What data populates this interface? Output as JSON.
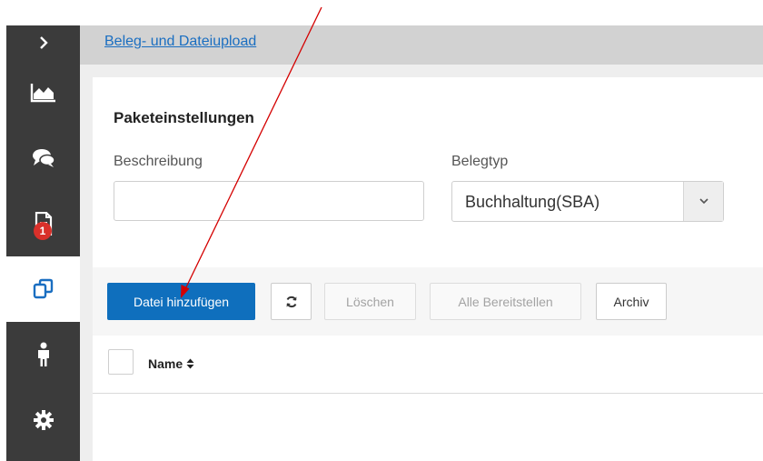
{
  "colors": {
    "sidebar_bg": "#3b3b3b",
    "primary": "#0f6fbd",
    "badge": "#d9302a",
    "link": "#1a6ec1",
    "annotation_arrow": "#d40000"
  },
  "sidebar": {
    "items": [
      {
        "icon": "chevron-right-icon"
      },
      {
        "icon": "area-chart-icon"
      },
      {
        "icon": "chat-icon"
      },
      {
        "icon": "document-icon",
        "badge": "1"
      },
      {
        "icon": "copy-icon",
        "active": true
      },
      {
        "icon": "person-icon"
      },
      {
        "icon": "gear-icon"
      }
    ]
  },
  "header": {
    "breadcrumb": "Beleg- und Dateiupload"
  },
  "form": {
    "title": "Paketeinstellungen",
    "description_label": "Beschreibung",
    "description_value": "",
    "doc_type_label": "Belegtyp",
    "doc_type_value": "Buchhaltung(SBA)"
  },
  "toolbar": {
    "add_file": "Datei hinzufügen",
    "refresh_icon": "refresh-icon",
    "delete": "Löschen",
    "provide_all": "Alle Bereitstellen",
    "archive": "Archiv"
  },
  "table": {
    "columns": [
      {
        "label": "Name",
        "sort_icon": "sort-icon"
      }
    ]
  }
}
